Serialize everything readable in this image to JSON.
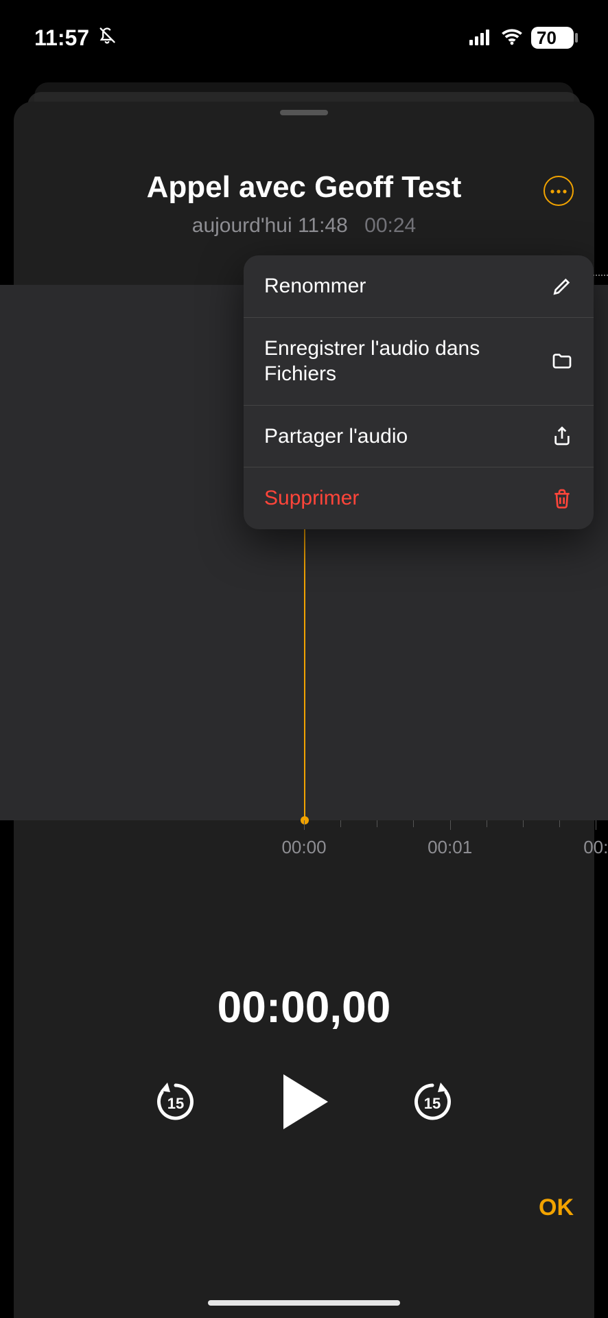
{
  "status": {
    "time": "11:57",
    "battery": "70"
  },
  "recording": {
    "title": "Appel avec Geoff Test",
    "date": "aujourd'hui 11:48",
    "duration": "00:24"
  },
  "menu": {
    "rename": "Renommer",
    "save": "Enregistrer l'audio dans Fichiers",
    "share": "Partager l'audio",
    "delete": "Supprimer"
  },
  "timeline": {
    "t0": "00:00",
    "t1": "00:01",
    "t2": "00:"
  },
  "player": {
    "elapsed": "00:00,00",
    "skip": "15"
  },
  "actions": {
    "ok": "OK"
  },
  "colors": {
    "accent": "#f2a300",
    "destructive": "#ff453a"
  }
}
